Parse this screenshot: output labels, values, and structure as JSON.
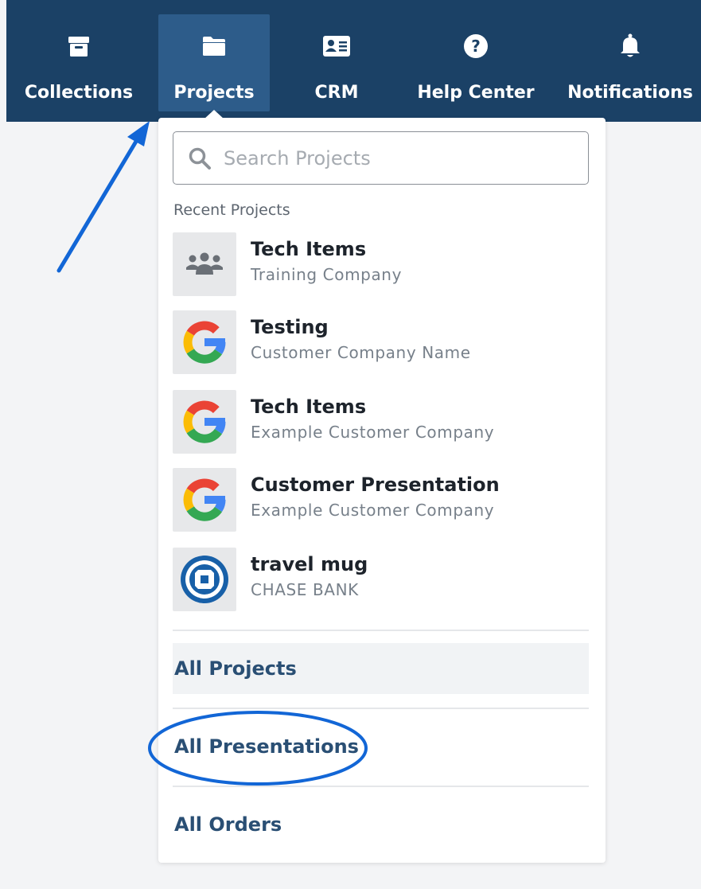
{
  "nav": {
    "items": [
      {
        "label": "Collections",
        "icon": "archive-box-icon"
      },
      {
        "label": "Projects",
        "icon": "folder-icon",
        "active": true
      },
      {
        "label": "CRM",
        "icon": "contact-card-icon"
      },
      {
        "label": "Help Center",
        "icon": "question-circle-icon"
      },
      {
        "label": "Notifications",
        "icon": "bell-icon"
      }
    ]
  },
  "dropdown": {
    "search": {
      "placeholder": "Search Projects",
      "value": ""
    },
    "recent_label": "Recent Projects",
    "projects": [
      {
        "name": "Tech Items",
        "company": "Training Company",
        "thumb": "people-group-icon"
      },
      {
        "name": "Testing",
        "company": "Customer Company Name",
        "thumb": "google-logo-icon"
      },
      {
        "name": "Tech Items",
        "company": "Example Customer Company",
        "thumb": "google-logo-icon"
      },
      {
        "name": "Customer Presentation",
        "company": "Example Customer Company",
        "thumb": "google-logo-icon"
      },
      {
        "name": "travel mug",
        "company": "CHASE BANK",
        "thumb": "chase-logo-icon"
      }
    ],
    "links": {
      "all_projects": "All Projects",
      "all_presentations": "All Presentations",
      "all_orders": "All Orders"
    }
  },
  "colors": {
    "nav_bg": "#1b4166",
    "nav_active": "#2d5c8a",
    "link_text": "#2a4f74",
    "annotation_blue": "#1266d6"
  }
}
